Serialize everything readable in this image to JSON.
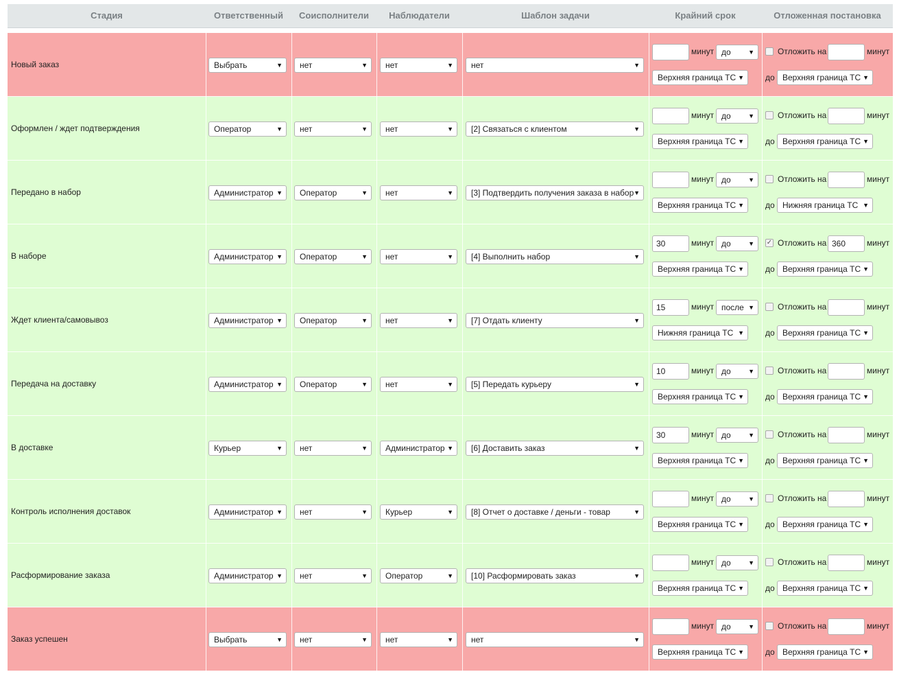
{
  "headers": {
    "stage": "Стадия",
    "responsible": "Ответственный",
    "coexecutors": "Соисполнители",
    "observers": "Наблюдатели",
    "template": "Шаблон задачи",
    "deadline": "Крайний срок",
    "delayed": "Отложенная постановка"
  },
  "labels": {
    "minutes": "минут",
    "postpone": "Отложить на",
    "until": "до"
  },
  "colors": {
    "red_row": "#f8a8a8",
    "green_row": "#dffdd3",
    "header": "#e3e7e8"
  },
  "rows": [
    {
      "color": "red",
      "stage": "Новый заказ",
      "responsible": "Выбрать",
      "coexecutors": "нет",
      "observers": "нет",
      "template": "нет",
      "deadline_minutes": "",
      "deadline_rel": "до",
      "deadline_bound": "Верхняя граница ТС",
      "postpone_checked": false,
      "postpone_minutes": "",
      "postpone_bound": "Верхняя граница ТС"
    },
    {
      "color": "green",
      "stage": "Оформлен / ждет подтверждения",
      "responsible": "Оператор",
      "coexecutors": "нет",
      "observers": "нет",
      "template": "[2] Связаться с клиентом",
      "deadline_minutes": "",
      "deadline_rel": "до",
      "deadline_bound": "Верхняя граница ТС",
      "postpone_checked": false,
      "postpone_minutes": "",
      "postpone_bound": "Верхняя граница ТС"
    },
    {
      "color": "green",
      "stage": "Передано в набор",
      "responsible": "Администратор",
      "coexecutors": "Оператор",
      "observers": "нет",
      "template": "[3] Подтвердить получения заказа в набор",
      "deadline_minutes": "",
      "deadline_rel": "до",
      "deadline_bound": "Верхняя граница ТС",
      "postpone_checked": false,
      "postpone_minutes": "",
      "postpone_bound": "Нижняя граница ТС"
    },
    {
      "color": "green",
      "stage": "В наборе",
      "responsible": "Администратор",
      "coexecutors": "Оператор",
      "observers": "нет",
      "template": "[4] Выполнить набор",
      "deadline_minutes": "30",
      "deadline_rel": "до",
      "deadline_bound": "Верхняя граница ТС",
      "postpone_checked": true,
      "postpone_minutes": "360",
      "postpone_bound": "Верхняя граница ТС"
    },
    {
      "color": "green",
      "stage": "Ждет клиента/самовывоз",
      "responsible": "Администратор",
      "coexecutors": "Оператор",
      "observers": "нет",
      "template": "[7] Отдать клиенту",
      "deadline_minutes": "15",
      "deadline_rel": "после",
      "deadline_bound": "Нижняя граница ТС",
      "postpone_checked": false,
      "postpone_minutes": "",
      "postpone_bound": "Верхняя граница ТС"
    },
    {
      "color": "green",
      "stage": "Передача на доставку",
      "responsible": "Администратор",
      "coexecutors": "Оператор",
      "observers": "нет",
      "template": "[5] Передать курьеру",
      "deadline_minutes": "10",
      "deadline_rel": "до",
      "deadline_bound": "Верхняя граница ТС",
      "postpone_checked": false,
      "postpone_minutes": "",
      "postpone_bound": "Верхняя граница ТС"
    },
    {
      "color": "green",
      "stage": "В доставке",
      "responsible": "Курьер",
      "coexecutors": "нет",
      "observers": "Администратор",
      "template": "[6] Доставить заказ",
      "deadline_minutes": "30",
      "deadline_rel": "до",
      "deadline_bound": "Верхняя граница ТС",
      "postpone_checked": false,
      "postpone_minutes": "",
      "postpone_bound": "Верхняя граница ТС"
    },
    {
      "color": "green",
      "stage": "Контроль исполнения доставок",
      "responsible": "Администратор",
      "coexecutors": "нет",
      "observers": "Курьер",
      "template": "[8] Отчет о доставке / деньги - товар",
      "deadline_minutes": "",
      "deadline_rel": "до",
      "deadline_bound": "Верхняя граница ТС",
      "postpone_checked": false,
      "postpone_minutes": "",
      "postpone_bound": "Верхняя граница ТС"
    },
    {
      "color": "green",
      "stage": "Расформирование заказа",
      "responsible": "Администратор",
      "coexecutors": "нет",
      "observers": "Оператор",
      "template": "[10] Расформировать заказ",
      "deadline_minutes": "",
      "deadline_rel": "до",
      "deadline_bound": "Верхняя граница ТС",
      "postpone_checked": false,
      "postpone_minutes": "",
      "postpone_bound": "Верхняя граница ТС"
    },
    {
      "color": "red",
      "stage": "Заказ успешен",
      "responsible": "Выбрать",
      "coexecutors": "нет",
      "observers": "нет",
      "template": "нет",
      "deadline_minutes": "",
      "deadline_rel": "до",
      "deadline_bound": "Верхняя граница ТС",
      "postpone_checked": false,
      "postpone_minutes": "",
      "postpone_bound": "Верхняя граница ТС"
    }
  ]
}
